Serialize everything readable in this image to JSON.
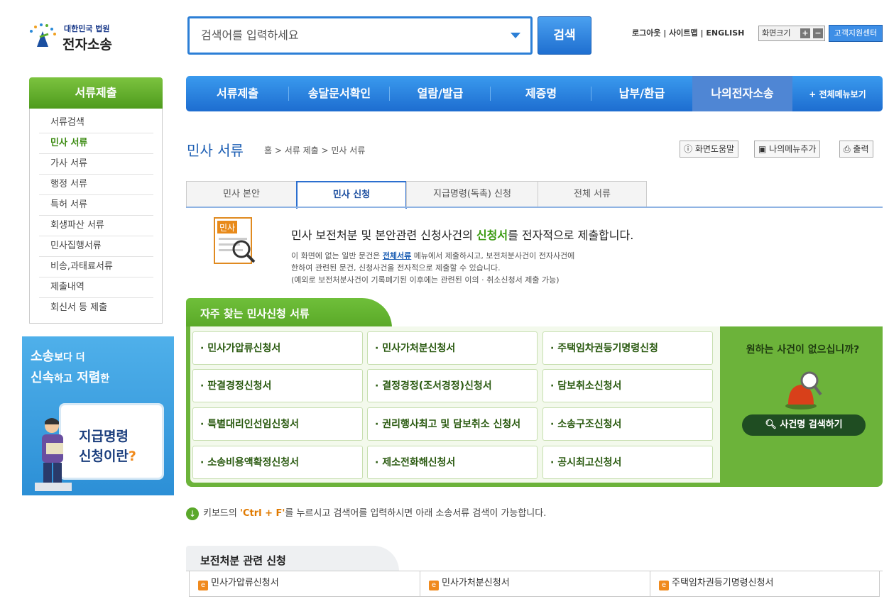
{
  "logo": {
    "line1": "대한민국 법원",
    "line2": "전자소송"
  },
  "search": {
    "placeholder": "검색어를 입력하세요",
    "button": "검색"
  },
  "util": {
    "logout": "로그아웃",
    "sitemap": "사이트맵",
    "english": "ENGLISH",
    "screen_size": "화면크기",
    "plus": "+",
    "minus": "−",
    "support": "고객지원센터"
  },
  "sidebar": {
    "title": "서류제출",
    "items": [
      {
        "label": "서류검색"
      },
      {
        "label": "민사 서류"
      },
      {
        "label": "가사 서류"
      },
      {
        "label": "행정 서류"
      },
      {
        "label": "특허 서류"
      },
      {
        "label": "회생파산 서류"
      },
      {
        "label": "민사집행서류"
      },
      {
        "label": "비송,과태료서류"
      },
      {
        "label": "제출내역"
      },
      {
        "label": "회신서 등 제출"
      }
    ]
  },
  "banner": {
    "t1a": "소송",
    "t1b": "보다 더",
    "t2a": "신속",
    "t2b": "하고",
    "t2c": "저렴",
    "t2d": "한",
    "c1": "지급명령",
    "c2": "신청이란",
    "c2q": "?"
  },
  "gnb": {
    "items": [
      "서류제출",
      "송달문서확인",
      "열람/발급",
      "제증명",
      "납부/환급",
      "나의전자소송"
    ],
    "all": "+ 전체메뉴보기"
  },
  "page": {
    "title": "민사 서류",
    "breadcrumb": "홈 > 서류 제출 > 민사 서류",
    "help": "화면도움말",
    "mymenu": "나의메뉴추가",
    "print": "출력"
  },
  "tabs": [
    "민사 본안",
    "민사 신청",
    "지급명령(독촉) 신청",
    "전체 서류"
  ],
  "intro": {
    "icon_label": "민사",
    "main_a": "민사 보전처분 및 본안관련 신청사건의 ",
    "main_b": "신청서",
    "main_c": "를 전자적으로 제출합니다.",
    "sub1_a": "이 화면에 없는 일반 문건은 ",
    "sub1_b": "전체서류",
    "sub1_c": " 메뉴에서 제출하시고, 보전처분사건이 전자사건에",
    "sub2": "한하여 관련된 문건, 신청사건을 전자적으로 제출할 수 있습니다.",
    "sub3": "(예외로 보전처분사건이 기록폐기된 이후에는 관련된 이의 · 취소신청서 제출 가능)"
  },
  "frequent": {
    "title": "자주 찾는 민사신청 서류",
    "items": [
      "· 민사가압류신청서",
      "· 민사가처분신청서",
      "· 주택임차권등기명령신청",
      "· 판결경정신청서",
      "· 결정경정(조서경정)신청서",
      "· 담보취소신청서",
      "· 특별대리인선임신청서",
      "· 권리행사최고 및 담보취소 신청서",
      "· 소송구조신청서",
      "· 소송비용액확정신청서",
      "· 제소전화해신청서",
      "· 공시최고신청서"
    ],
    "question": "원하는 사건이 없으십니까?",
    "case_search": "사건명 검색하기"
  },
  "hint": {
    "a": "키보드의 ",
    "b": "'Ctrl + F'",
    "c": "를 누르시고 검색어를 입력하시면 아래 소송서류 검색이 가능합니다."
  },
  "section": {
    "title": "보전처분 관련 신청",
    "items": [
      "민사가압류신청서",
      "민사가처분신청서",
      "주택임차권등기명령신청서"
    ]
  }
}
